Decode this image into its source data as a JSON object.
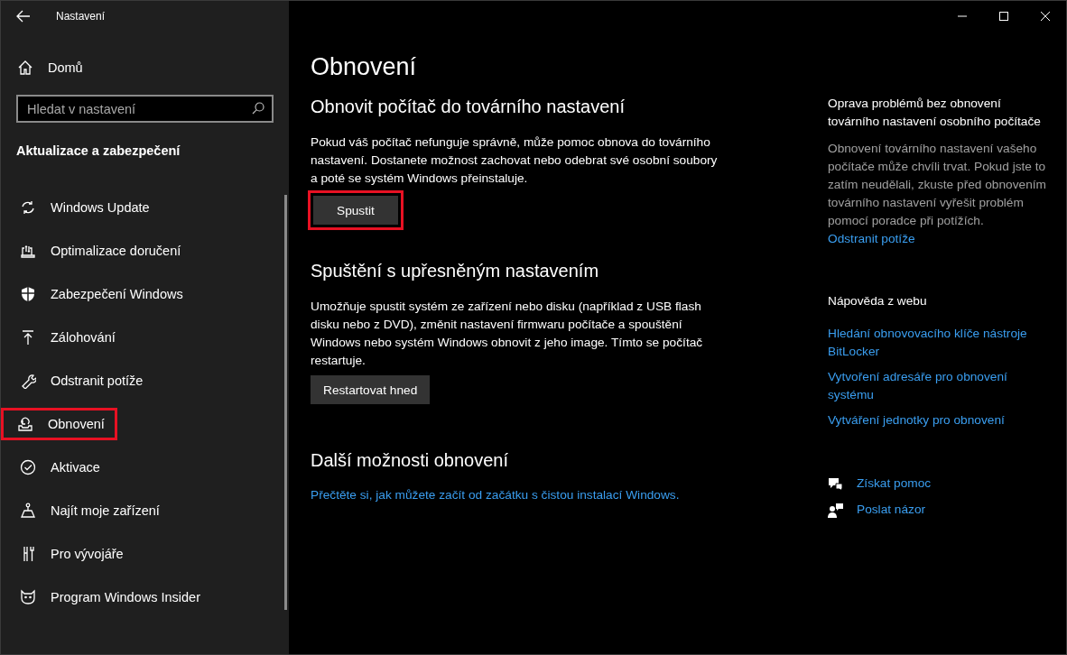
{
  "window": {
    "title": "Nastavení"
  },
  "sidebar": {
    "home": "Domů",
    "search": {
      "placeholder": "Hledat v nastavení"
    },
    "section": "Aktualizace a zabezpečení",
    "items": [
      {
        "label": "Windows Update",
        "highlighted": false
      },
      {
        "label": "Optimalizace doručení",
        "highlighted": false
      },
      {
        "label": "Zabezpečení Windows",
        "highlighted": false
      },
      {
        "label": "Zálohování",
        "highlighted": false
      },
      {
        "label": "Odstranit potíže",
        "highlighted": false
      },
      {
        "label": "Obnovení",
        "highlighted": true
      },
      {
        "label": "Aktivace",
        "highlighted": false
      },
      {
        "label": "Najít moje zařízení",
        "highlighted": false
      },
      {
        "label": "Pro vývojáře",
        "highlighted": false
      },
      {
        "label": "Program Windows Insider",
        "highlighted": false
      }
    ]
  },
  "page": {
    "title": "Obnovení",
    "sections": [
      {
        "heading": "Obnovit počítač do továrního nastavení",
        "text": "Pokud váš počítač nefunguje správně, může pomoc obnova do továrního nastavení. Dostanete možnost zachovat nebo odebrat své osobní soubory a poté se systém Windows přeinstaluje.",
        "kind": "button",
        "action": "Spustit",
        "highlighted": true
      },
      {
        "heading": "Spuštění s upřesněným nastavením",
        "text": "Umožňuje spustit systém ze zařízení nebo disku (například z USB flash disku nebo z DVD), změnit nastavení firmwaru počítače a spouštění Windows nebo systém Windows obnovit z jeho image. Tímto se počítač restartuje.",
        "kind": "button",
        "action": "Restartovat hned",
        "highlighted": false
      },
      {
        "heading": "Další možnosti obnovení",
        "kind": "link",
        "action": "Přečtěte si, jak můžete začít od začátku s čistou instalací Windows."
      }
    ]
  },
  "aside": {
    "fix": {
      "heading": "Oprava problémů bez obnovení továrního nastavení osobního počítače",
      "text": "Obnovení továrního nastavení vašeho počítače může chvíli trvat. Pokud jste to zatím neudělali, zkuste před obnovením továrního nastavení vyřešit problém pomocí poradce při potížích.",
      "link": "Odstranit potíže"
    },
    "help": {
      "heading": "Nápověda z webu",
      "links": [
        "Hledání obnovovacího klíče nástroje BitLocker",
        "Vytvoření adresáře pro obnovení systému",
        "Vytváření jednotky pro obnovení"
      ]
    },
    "actions": [
      "Získat pomoc",
      "Poslat názor"
    ]
  }
}
